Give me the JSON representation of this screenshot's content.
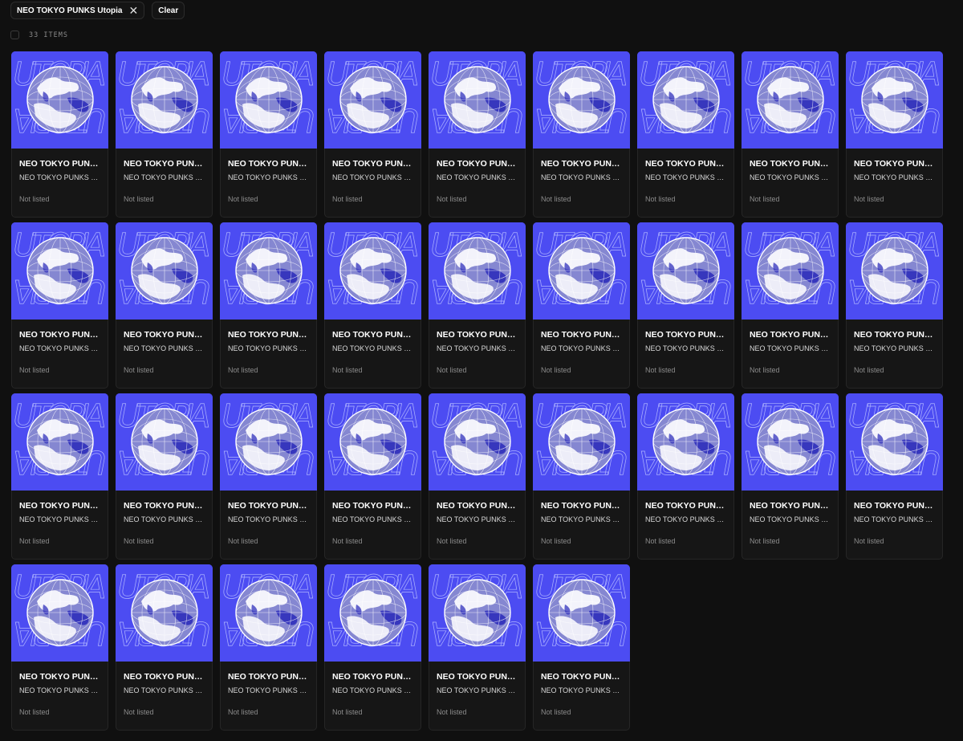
{
  "filters": {
    "chip_label": "NEO TOKYO PUNKS Utopia",
    "close_glyph": "✕",
    "clear_label": "Clear"
  },
  "results": {
    "count_label": "33 ITEMS"
  },
  "colors": {
    "background": "#101010",
    "card_meta": "#161616",
    "art_background": "#4c4cf2"
  },
  "artwork": {
    "text_line_1": "UTOPIA",
    "text_line_2": "UTOPIA"
  },
  "items": [
    {
      "title": "NEO TOKYO PUNKS Utopia",
      "collection": "NEO TOKYO PUNKS Utopia",
      "status": "Not listed"
    },
    {
      "title": "NEO TOKYO PUNKS Utopia",
      "collection": "NEO TOKYO PUNKS Utopia",
      "status": "Not listed"
    },
    {
      "title": "NEO TOKYO PUNKS Utopia",
      "collection": "NEO TOKYO PUNKS Utopia",
      "status": "Not listed"
    },
    {
      "title": "NEO TOKYO PUNKS Utopia",
      "collection": "NEO TOKYO PUNKS Utopia",
      "status": "Not listed"
    },
    {
      "title": "NEO TOKYO PUNKS Utopia",
      "collection": "NEO TOKYO PUNKS Utopia",
      "status": "Not listed"
    },
    {
      "title": "NEO TOKYO PUNKS Utopia",
      "collection": "NEO TOKYO PUNKS Utopia",
      "status": "Not listed"
    },
    {
      "title": "NEO TOKYO PUNKS Utopia",
      "collection": "NEO TOKYO PUNKS Utopia",
      "status": "Not listed"
    },
    {
      "title": "NEO TOKYO PUNKS Utopia",
      "collection": "NEO TOKYO PUNKS Utopia",
      "status": "Not listed"
    },
    {
      "title": "NEO TOKYO PUNKS Utopia",
      "collection": "NEO TOKYO PUNKS Utopia",
      "status": "Not listed"
    },
    {
      "title": "NEO TOKYO PUNKS Utopia",
      "collection": "NEO TOKYO PUNKS Utopia",
      "status": "Not listed"
    },
    {
      "title": "NEO TOKYO PUNKS Utopia",
      "collection": "NEO TOKYO PUNKS Utopia",
      "status": "Not listed"
    },
    {
      "title": "NEO TOKYO PUNKS Utopia",
      "collection": "NEO TOKYO PUNKS Utopia",
      "status": "Not listed"
    },
    {
      "title": "NEO TOKYO PUNKS Utopia",
      "collection": "NEO TOKYO PUNKS Utopia",
      "status": "Not listed"
    },
    {
      "title": "NEO TOKYO PUNKS Utopia",
      "collection": "NEO TOKYO PUNKS Utopia",
      "status": "Not listed"
    },
    {
      "title": "NEO TOKYO PUNKS Utopia",
      "collection": "NEO TOKYO PUNKS Utopia",
      "status": "Not listed"
    },
    {
      "title": "NEO TOKYO PUNKS Utopia",
      "collection": "NEO TOKYO PUNKS Utopia",
      "status": "Not listed"
    },
    {
      "title": "NEO TOKYO PUNKS Utopia",
      "collection": "NEO TOKYO PUNKS Utopia",
      "status": "Not listed"
    },
    {
      "title": "NEO TOKYO PUNKS Utopia",
      "collection": "NEO TOKYO PUNKS Utopia",
      "status": "Not listed"
    },
    {
      "title": "NEO TOKYO PUNKS Utopia",
      "collection": "NEO TOKYO PUNKS Utopia",
      "status": "Not listed"
    },
    {
      "title": "NEO TOKYO PUNKS Utopia",
      "collection": "NEO TOKYO PUNKS Utopia",
      "status": "Not listed"
    },
    {
      "title": "NEO TOKYO PUNKS Utopia",
      "collection": "NEO TOKYO PUNKS Utopia",
      "status": "Not listed"
    },
    {
      "title": "NEO TOKYO PUNKS Utopia",
      "collection": "NEO TOKYO PUNKS Utopia",
      "status": "Not listed"
    },
    {
      "title": "NEO TOKYO PUNKS Utopia",
      "collection": "NEO TOKYO PUNKS Utopia",
      "status": "Not listed"
    },
    {
      "title": "NEO TOKYO PUNKS Utopia",
      "collection": "NEO TOKYO PUNKS Utopia",
      "status": "Not listed"
    },
    {
      "title": "NEO TOKYO PUNKS Utopia",
      "collection": "NEO TOKYO PUNKS Utopia",
      "status": "Not listed"
    },
    {
      "title": "NEO TOKYO PUNKS Utopia",
      "collection": "NEO TOKYO PUNKS Utopia",
      "status": "Not listed"
    },
    {
      "title": "NEO TOKYO PUNKS Utopia",
      "collection": "NEO TOKYO PUNKS Utopia",
      "status": "Not listed"
    },
    {
      "title": "NEO TOKYO PUNKS Utopia",
      "collection": "NEO TOKYO PUNKS Utopia",
      "status": "Not listed"
    },
    {
      "title": "NEO TOKYO PUNKS Utopia",
      "collection": "NEO TOKYO PUNKS Utopia",
      "status": "Not listed"
    },
    {
      "title": "NEO TOKYO PUNKS Utopia",
      "collection": "NEO TOKYO PUNKS Utopia",
      "status": "Not listed"
    },
    {
      "title": "NEO TOKYO PUNKS Utopia",
      "collection": "NEO TOKYO PUNKS Utopia",
      "status": "Not listed"
    },
    {
      "title": "NEO TOKYO PUNKS Utopia",
      "collection": "NEO TOKYO PUNKS Utopia",
      "status": "Not listed"
    },
    {
      "title": "NEO TOKYO PUNKS Utopia",
      "collection": "NEO TOKYO PUNKS Utopia",
      "status": "Not listed"
    }
  ]
}
